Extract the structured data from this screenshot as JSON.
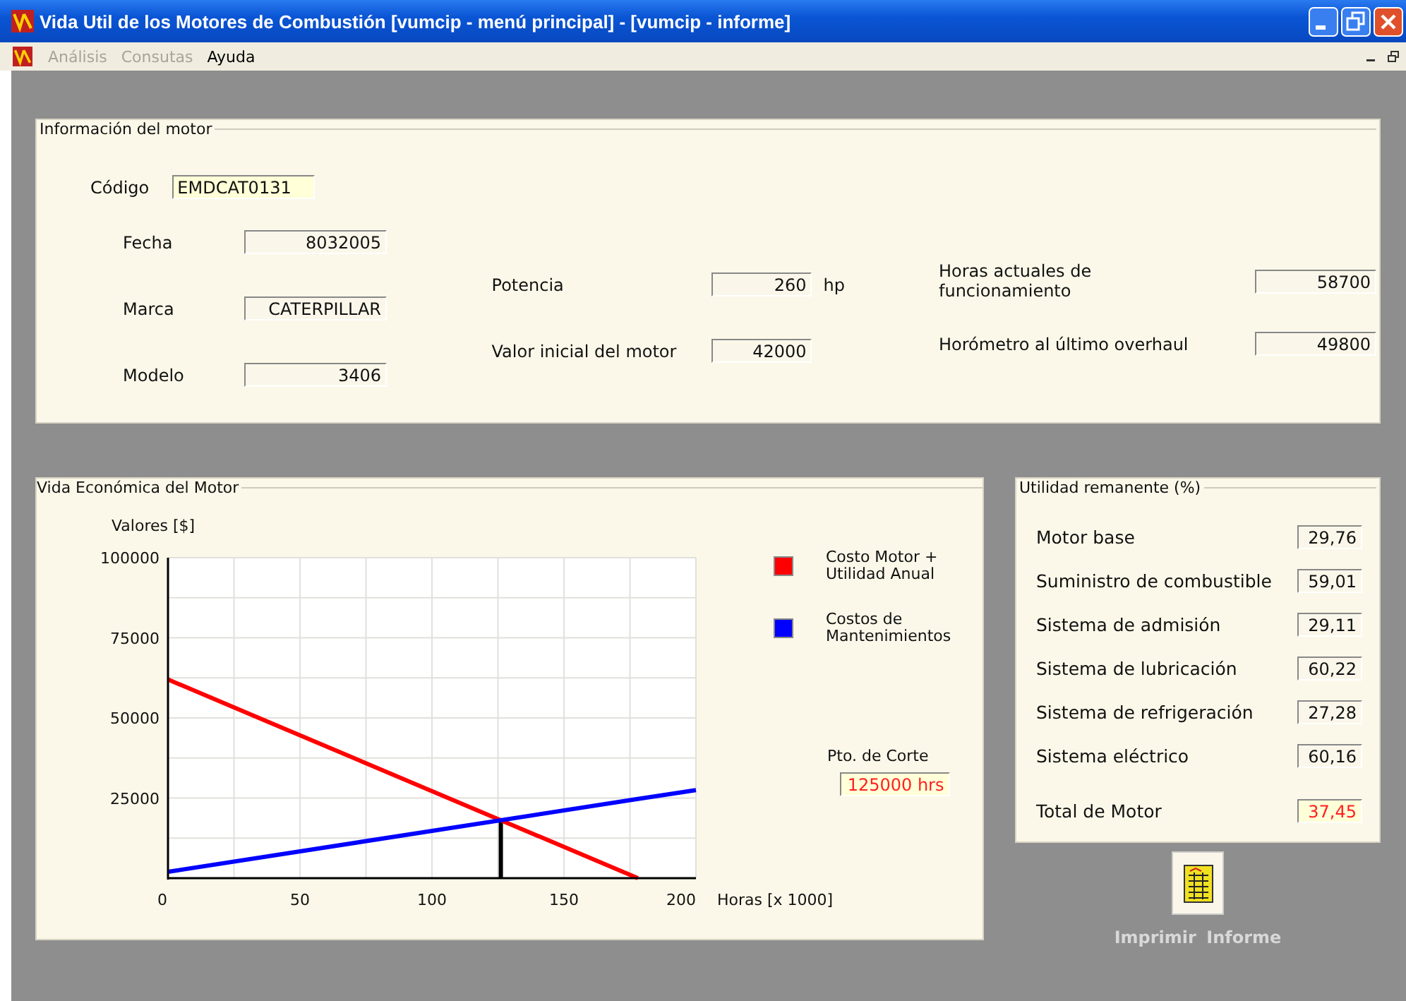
{
  "window": {
    "title": "Vida Util de los Motores de Combustión [vumcip - menú principal] - [vumcip - informe]"
  },
  "menu": [
    {
      "label": "Análisis",
      "disabled": true
    },
    {
      "label": "Consutas",
      "disabled": true
    },
    {
      "label": "Ayuda",
      "disabled": false
    }
  ],
  "motor_info": {
    "title": "Información del motor",
    "code": {
      "label": "Código",
      "value": "EMDCAT0131"
    },
    "left_fields": [
      {
        "label": "Fecha",
        "value": "8032005"
      },
      {
        "label": "Marca",
        "value": "CATERPILLAR"
      },
      {
        "label": "Modelo",
        "value": "3406"
      }
    ],
    "middle_fields": [
      {
        "label": "Potencia",
        "value": "260",
        "unit": "hp"
      },
      {
        "label": "Valor inicial del motor",
        "value": "42000"
      }
    ],
    "right_fields": [
      {
        "label": "Horas actuales de funcionamiento",
        "value": "58700"
      },
      {
        "label": "Horómetro al último overhaul",
        "value": "49800"
      }
    ]
  },
  "economic_life": {
    "title": "Vida Económica del Motor",
    "chart_data": {
      "type": "line",
      "xlabel": "Horas [x 1000]",
      "ylabel": "Valores [$]",
      "x": [
        0,
        178,
        200
      ],
      "series": [
        {
          "name": "Costo Motor +\nUtilidad Anual",
          "color": "#ff0000",
          "values": [
            62000,
            0,
            null
          ]
        },
        {
          "name": "Costos de\nMantenimientos",
          "color": "#0000ff",
          "values": [
            2000,
            24700,
            27500
          ]
        }
      ],
      "xlim": [
        0,
        200
      ],
      "ylim": [
        0,
        100000
      ],
      "xticks": [
        0,
        50,
        100,
        150,
        200
      ],
      "yticks": [
        25000,
        50000,
        75000,
        100000
      ],
      "grid": true
    },
    "cutoff": {
      "label": "Pto. de Corte",
      "value": "125000 hrs",
      "highlight": true
    }
  },
  "remaining_utility": {
    "title": "Utilidad remanente (%)",
    "rows": [
      {
        "label": "Motor base",
        "value": "29,76",
        "highlight": false
      },
      {
        "label": "Suministro de combustible",
        "value": "59,01",
        "highlight": false
      },
      {
        "label": "Sistema de admisión",
        "value": "29,11",
        "highlight": false
      },
      {
        "label": "Sistema de lubricación",
        "value": "60,22",
        "highlight": false
      },
      {
        "label": "Sistema de refrigeración",
        "value": "27,28",
        "highlight": false
      },
      {
        "label": "Sistema eléctrico",
        "value": "60,16",
        "highlight": false
      }
    ],
    "total": {
      "label": "Total de Motor",
      "value": "37,45",
      "highlight": true
    }
  },
  "print": {
    "label": "Imprimir Informe"
  }
}
